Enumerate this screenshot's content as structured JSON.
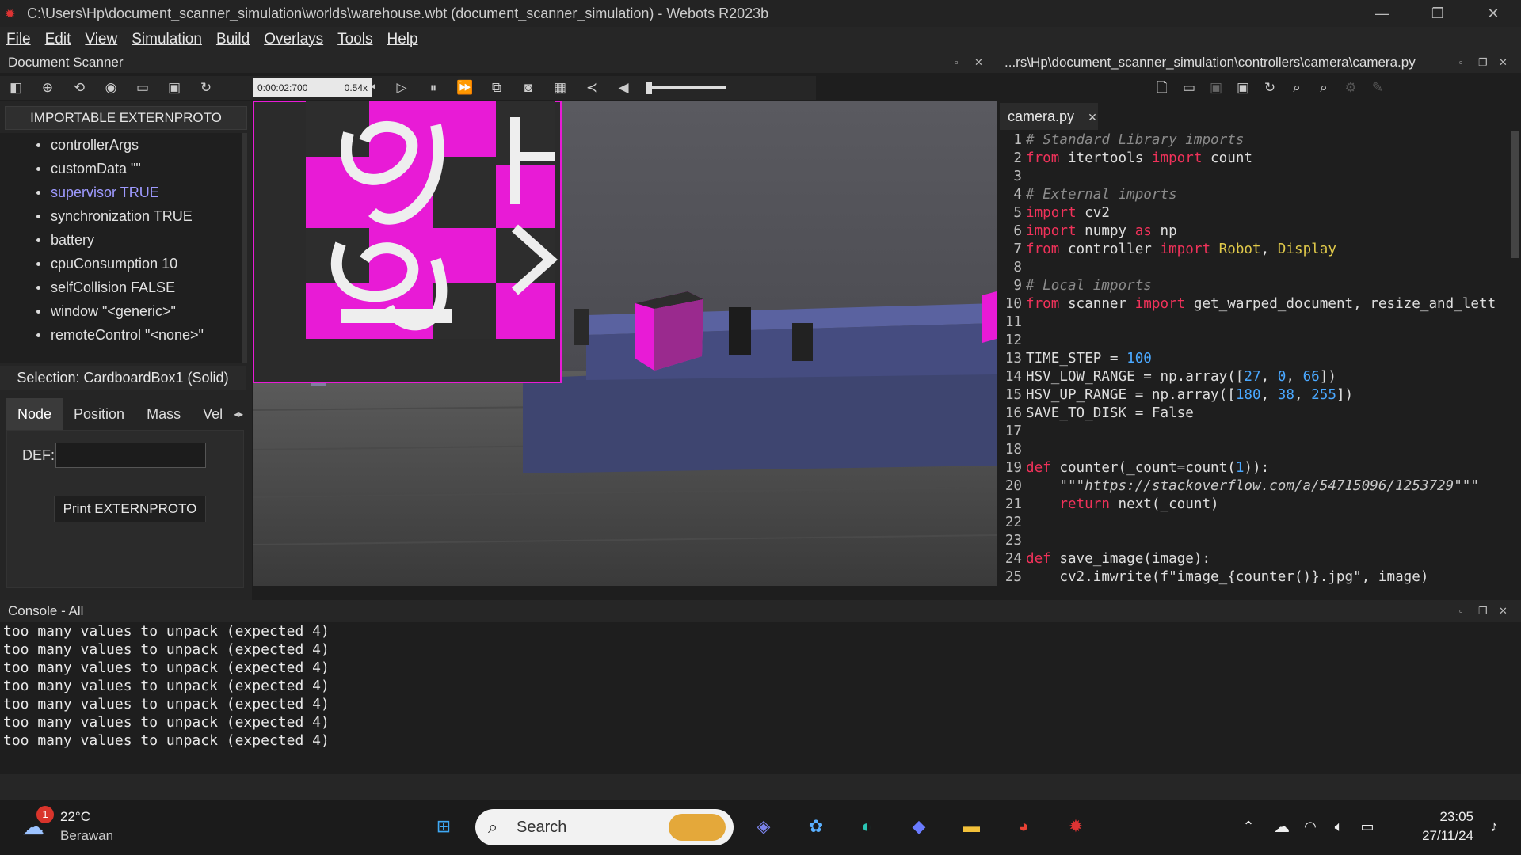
{
  "window": {
    "title": "C:\\Users\\Hp\\document_scanner_simulation\\worlds\\warehouse.wbt (document_scanner_simulation) - Webots R2023b"
  },
  "menu": [
    "File",
    "Edit",
    "View",
    "Simulation",
    "Build",
    "Overlays",
    "Tools",
    "Help"
  ],
  "scene_tree": {
    "panel_title": "Document Scanner",
    "importable_button": "IMPORTABLE EXTERNPROTO",
    "fields": [
      {
        "label": "controllerArgs",
        "highlight": false
      },
      {
        "label": "customData \"\"",
        "highlight": false
      },
      {
        "label": "supervisor TRUE",
        "highlight": true
      },
      {
        "label": "synchronization TRUE",
        "highlight": false
      },
      {
        "label": "battery",
        "highlight": false
      },
      {
        "label": "cpuConsumption 10",
        "highlight": false
      },
      {
        "label": "selfCollision FALSE",
        "highlight": false
      },
      {
        "label": "window \"<generic>\"",
        "highlight": false
      },
      {
        "label": "remoteControl \"<none>\"",
        "highlight": false
      }
    ],
    "selection": "Selection: CardboardBox1 (Solid)",
    "tabs": [
      "Node",
      "Position",
      "Mass",
      "Vel"
    ],
    "def_label": "DEF:",
    "def_value": "",
    "print_button": "Print EXTERNPROTO"
  },
  "sim_toolbar": {
    "time": "0:00:02:700",
    "speed": "0.54x"
  },
  "editor": {
    "path": "...rs\\Hp\\document_scanner_simulation\\controllers\\camera\\camera.py",
    "tab": "camera.py"
  },
  "code_lines": [
    "# Standard Library imports",
    "from itertools import count",
    "",
    "# External imports",
    "import cv2",
    "import numpy as np",
    "from controller import Robot, Display",
    "",
    "# Local imports",
    "from scanner import get_warped_document, resize_and_lett",
    "",
    "",
    "TIME_STEP = 100",
    "HSV_LOW_RANGE = np.array([27, 0, 66])",
    "HSV_UP_RANGE = np.array([180, 38, 255])",
    "SAVE_TO_DISK = False",
    "",
    "",
    "def counter(_count=count(1)):",
    "    \"\"\"https://stackoverflow.com/a/54715096/1253729\"\"\"",
    "    return next(_count)",
    "",
    "",
    "def save_image(image):",
    "    cv2.imwrite(f\"image_{counter()}.jpg\", image)"
  ],
  "console": {
    "title": "Console - All",
    "lines": [
      "too many values to unpack (expected 4)",
      "too many values to unpack (expected 4)",
      "too many values to unpack (expected 4)",
      "too many values to unpack (expected 4)",
      "too many values to unpack (expected 4)",
      "too many values to unpack (expected 4)",
      "too many values to unpack (expected 4)"
    ]
  },
  "taskbar": {
    "weather_temp": "22°C",
    "weather_desc": "Berawan",
    "weather_badge": "1",
    "search_placeholder": "Search",
    "time": "23:05",
    "date": "27/11/24"
  },
  "colors": {
    "accent_pink": "#e81bd6",
    "keyword": "#f0325a",
    "number": "#4aa8ff",
    "class": "#e0c94a",
    "highlight_field": "#9e9aff"
  }
}
